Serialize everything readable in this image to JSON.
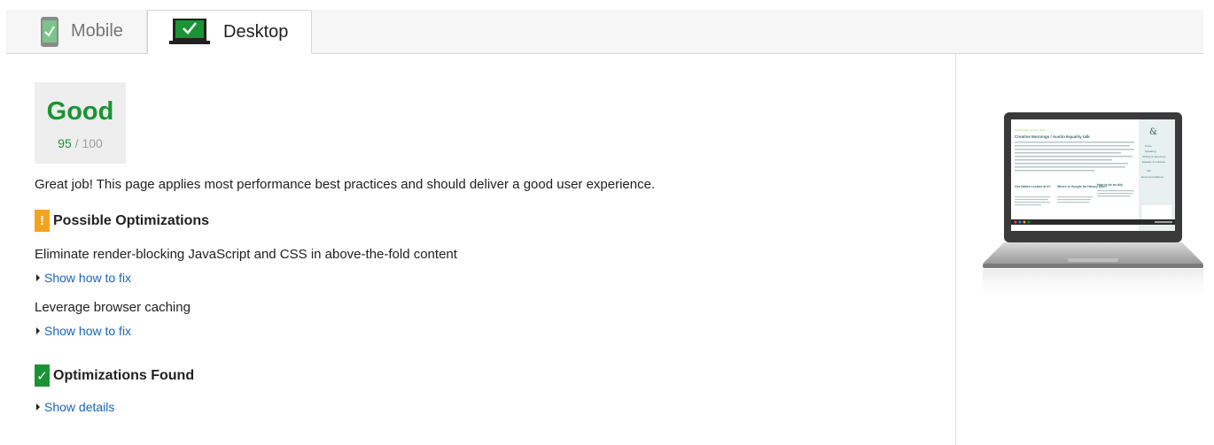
{
  "tabs": {
    "mobile": {
      "label": "Mobile"
    },
    "desktop": {
      "label": "Desktop"
    }
  },
  "score": {
    "label": "Good",
    "value": "95",
    "separator": "/",
    "max": "100"
  },
  "summary": "Great job! This page applies most performance best practices and should deliver a good user experience.",
  "possible_optimizations": {
    "badge": "!",
    "title": "Possible Optimizations",
    "rules": [
      {
        "title": "Eliminate render-blocking JavaScript and CSS in above-the-fold content",
        "link": "Show how to fix"
      },
      {
        "title": "Leverage browser caching",
        "link": "Show how to fix"
      }
    ]
  },
  "optimizations_found": {
    "badge": "✓",
    "title": "Optimizations Found",
    "link": "Show details"
  },
  "icons": {
    "mobile_tab": "mobile-check-icon",
    "desktop_tab": "desktop-check-icon",
    "preview": "laptop-preview"
  },
  "colors": {
    "good": "#1a9433",
    "warning": "#f4a321",
    "link": "#1565c0"
  },
  "preview_site": {
    "header_line": "Wednesday, 4th Jul, 2014",
    "headline": "Creative Mornings / Austin Equality talk",
    "col1_title": "Our Native Lecture at it?",
    "col2_title": "Where is Google for Harvey Akin?",
    "col3_title": "How to be an Ally",
    "nav": [
      "Posts",
      "Speaking",
      "Writing & Interviews",
      "Equality & Inclusion",
      "Info",
      "Recommendations"
    ]
  }
}
